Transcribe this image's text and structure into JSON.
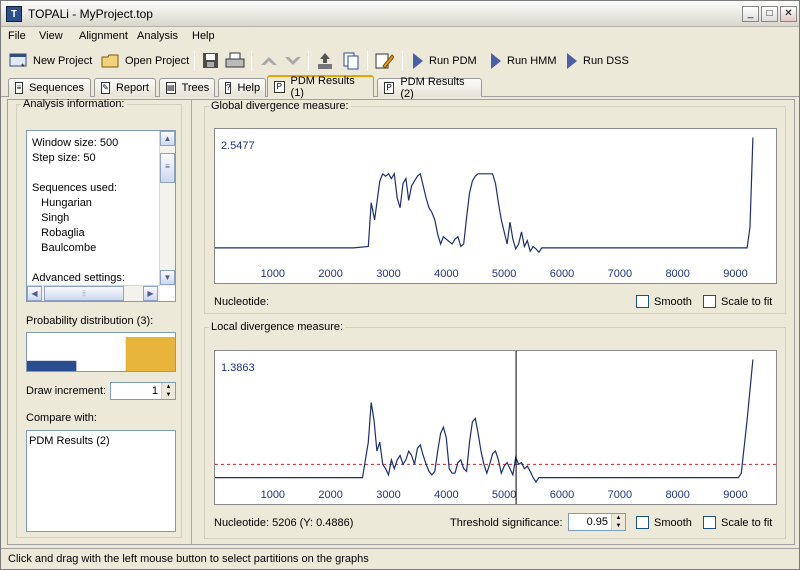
{
  "window": {
    "icon_label": "T",
    "title": "TOPALi - MyProject.top"
  },
  "menu": [
    "File",
    "View",
    "Alignment",
    "Analysis",
    "Help"
  ],
  "toolbar": {
    "new_project": "New Project",
    "open_project": "Open Project",
    "run_pdm": "Run PDM",
    "run_hmm": "Run HMM",
    "run_dss": "Run DSS"
  },
  "tabs": [
    "Sequences",
    "Report",
    "Trees",
    "Help",
    "PDM Results (1)",
    "PDM Results (2)"
  ],
  "active_tab": "PDM Results (1)",
  "left": {
    "analysis_title": "Analysis information:",
    "info_lines": [
      "Window size: 500",
      "Step size: 50",
      "",
      "Sequences used:",
      "  Hungarian",
      "  Singh",
      "  Robaglia",
      "  Baulcombe",
      "",
      "Advanced settings:"
    ],
    "prob_title": "Probability distribution (3):",
    "prob_values": [
      0.3,
      0.0,
      1.0
    ],
    "prob_colors": [
      "#2a4d8f",
      "#2a4d8f",
      "#e7b53c"
    ],
    "draw_increment_label": "Draw increment:",
    "draw_increment_value": "1",
    "compare_title": "Compare with:",
    "compare_items": [
      "PDM Results (2)"
    ]
  },
  "global": {
    "title": "Global divergence measure:",
    "max_label": "2.5477",
    "x_label": "Nucleotide:",
    "smooth_label": "Smooth",
    "scale_label": "Scale to fit"
  },
  "local": {
    "title": "Local divergence measure:",
    "max_label": "1.3863",
    "x_label": "Nucleotide: 5206  (Y: 0.4886)",
    "threshold_label": "Threshold significance:",
    "threshold_value": "0.95",
    "smooth_label": "Smooth",
    "scale_label": "Scale to fit"
  },
  "status": "Click and drag with the left mouse button to select partitions on the graphs",
  "chart_data": [
    {
      "type": "line",
      "title": "Global divergence measure:",
      "xlabel": "Nucleotide:",
      "xlim": [
        0,
        9700
      ],
      "ylim": [
        0,
        2.5477
      ],
      "x_ticks": [
        1000,
        2000,
        3000,
        4000,
        5000,
        6000,
        7000,
        8000,
        9000
      ],
      "series": [
        {
          "x": [
            0,
            2400,
            2650,
            2700,
            2760,
            2800,
            2850,
            2900,
            2950,
            3000,
            3050,
            3100,
            3150,
            3200,
            3250,
            3300,
            3350,
            3400,
            3450,
            3500,
            3550,
            3600,
            3650,
            3700,
            3750,
            3800,
            3850,
            3900,
            3950,
            4000,
            4050,
            4100,
            4150,
            4200,
            4250,
            4300,
            4350,
            4400,
            4450,
            4500,
            4550,
            4600,
            4650,
            4700,
            4750,
            4800,
            4850,
            4900,
            4950,
            5000,
            5050,
            5100,
            5150,
            5200,
            5250,
            5300,
            5350,
            5400,
            5450,
            5500,
            5550,
            5600,
            5650,
            9200,
            9250,
            9300
          ],
          "y": [
            0.27,
            0.27,
            0.3,
            1.2,
            0.85,
            1.2,
            1.65,
            1.8,
            1.75,
            1.8,
            1.7,
            1.8,
            1.3,
            1.1,
            1.6,
            1.7,
            1.25,
            1.55,
            1.65,
            1.75,
            1.8,
            1.55,
            1.3,
            1.1,
            1.0,
            0.85,
            0.55,
            0.35,
            0.5,
            0.45,
            0.4,
            0.35,
            0.45,
            0.5,
            0.3,
            0.35,
            0.9,
            1.4,
            1.65,
            1.75,
            1.8,
            1.8,
            1.8,
            1.8,
            1.8,
            1.8,
            1.6,
            1.2,
            0.85,
            0.6,
            0.35,
            0.8,
            0.45,
            0.25,
            0.35,
            0.6,
            0.3,
            0.42,
            0.2,
            0.3,
            0.25,
            0.18,
            0.27,
            0.27,
            0.7,
            2.5477
          ]
        }
      ]
    },
    {
      "type": "line",
      "title": "Local divergence measure:",
      "xlabel": "Nucleotide:",
      "xlim": [
        0,
        9700
      ],
      "ylim": [
        0,
        1.3863
      ],
      "x_ticks": [
        1000,
        2000,
        3000,
        4000,
        5000,
        6000,
        7000,
        8000,
        9000
      ],
      "threshold": 0.2,
      "cursor_x": 5206,
      "series": [
        {
          "x": [
            0,
            2400,
            2550,
            2650,
            2700,
            2750,
            2800,
            2850,
            2900,
            2950,
            3000,
            3050,
            3100,
            3150,
            3200,
            3250,
            3300,
            3350,
            3400,
            3450,
            3500,
            3550,
            3600,
            3650,
            3700,
            3750,
            3800,
            3850,
            3900,
            3950,
            4000,
            4050,
            4100,
            4150,
            4200,
            4250,
            4300,
            4350,
            4400,
            4450,
            4500,
            4550,
            4600,
            4650,
            4700,
            4750,
            4800,
            4850,
            4900,
            4950,
            5000,
            5050,
            5100,
            5150,
            5200,
            5250,
            5300,
            5350,
            5400,
            5450,
            5500,
            5550,
            5600,
            9050,
            9100,
            9200,
            9300
          ],
          "y": [
            0.05,
            0.05,
            0.05,
            0.45,
            0.9,
            0.7,
            0.35,
            0.45,
            0.2,
            0.15,
            0.08,
            0.25,
            0.15,
            0.25,
            0.3,
            0.2,
            0.25,
            0.35,
            0.3,
            0.2,
            0.38,
            0.42,
            0.3,
            0.2,
            0.12,
            0.08,
            0.12,
            0.35,
            0.55,
            0.62,
            0.5,
            0.15,
            0.1,
            0.1,
            0.22,
            0.25,
            0.15,
            0.12,
            0.45,
            0.68,
            0.72,
            0.55,
            0.35,
            0.2,
            0.1,
            0.2,
            0.32,
            0.35,
            0.25,
            0.1,
            0.18,
            0.22,
            0.15,
            0.08,
            0.28,
            0.2,
            0.22,
            0.15,
            0.18,
            0.12,
            0.05,
            0.0,
            0.05,
            0.05,
            0.1,
            0.7,
            1.3863
          ]
        }
      ]
    }
  ]
}
